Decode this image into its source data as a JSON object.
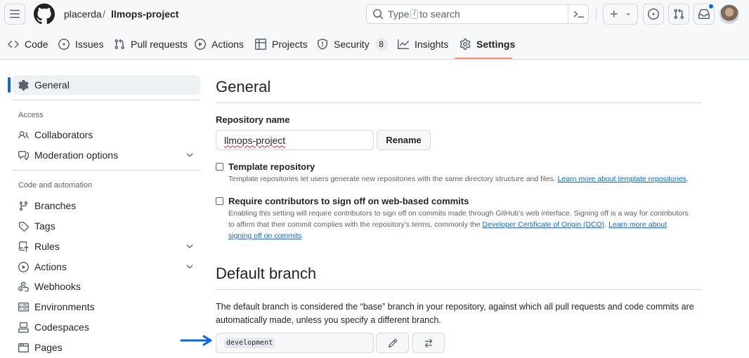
{
  "header": {
    "owner": "placerda",
    "separator": "/",
    "repo": "llmops-project",
    "search": {
      "prefix": "Type",
      "key": "/",
      "suffix": "to search"
    }
  },
  "nav": {
    "tabs": [
      {
        "label": "Code",
        "icon": "code-icon"
      },
      {
        "label": "Issues",
        "icon": "issue-icon"
      },
      {
        "label": "Pull requests",
        "icon": "pull-request-icon"
      },
      {
        "label": "Actions",
        "icon": "play-icon"
      },
      {
        "label": "Projects",
        "icon": "table-icon"
      },
      {
        "label": "Security",
        "icon": "shield-icon",
        "count": "8"
      },
      {
        "label": "Insights",
        "icon": "graph-icon"
      },
      {
        "label": "Settings",
        "icon": "gear-icon",
        "selected": true
      }
    ]
  },
  "sidebar": {
    "general": "General",
    "access_heading": "Access",
    "collaborators": "Collaborators",
    "moderation": "Moderation options",
    "automation_heading": "Code and automation",
    "branches": "Branches",
    "tags": "Tags",
    "rules": "Rules",
    "actions": "Actions",
    "webhooks": "Webhooks",
    "environments": "Environments",
    "codespaces": "Codespaces",
    "pages": "Pages"
  },
  "main": {
    "title": "General",
    "repo_name_label": "Repository name",
    "repo_name_value": "llmops-project",
    "rename_button": "Rename",
    "template": {
      "title": "Template repository",
      "desc": "Template repositories let users generate new repositories with the same directory structure and files.",
      "link": "Learn more about template repositories",
      "end": "."
    },
    "signoff": {
      "title": "Require contributors to sign off on web-based commits",
      "desc": "Enabling this setting will require contributors to sign off on commits made through GitHub’s web interface. Signing off is a way for contributors to affirm that their commit complies with the repository’s terms, commonly the",
      "link1": "Developer Certificate of Origin (DCO)",
      "mid": ".",
      "link2": "Learn more about signing off on commits",
      "end": "."
    },
    "default_branch": {
      "title": "Default branch",
      "desc": "The default branch is considered the “base” branch in your repository, against which all pull requests and code commits are automatically made, unless you specify a different branch.",
      "value": "development"
    }
  },
  "colors": {
    "accent": "#0969da",
    "tab_underline": "#fd8c73",
    "annotation_arrow": "#0969da"
  }
}
